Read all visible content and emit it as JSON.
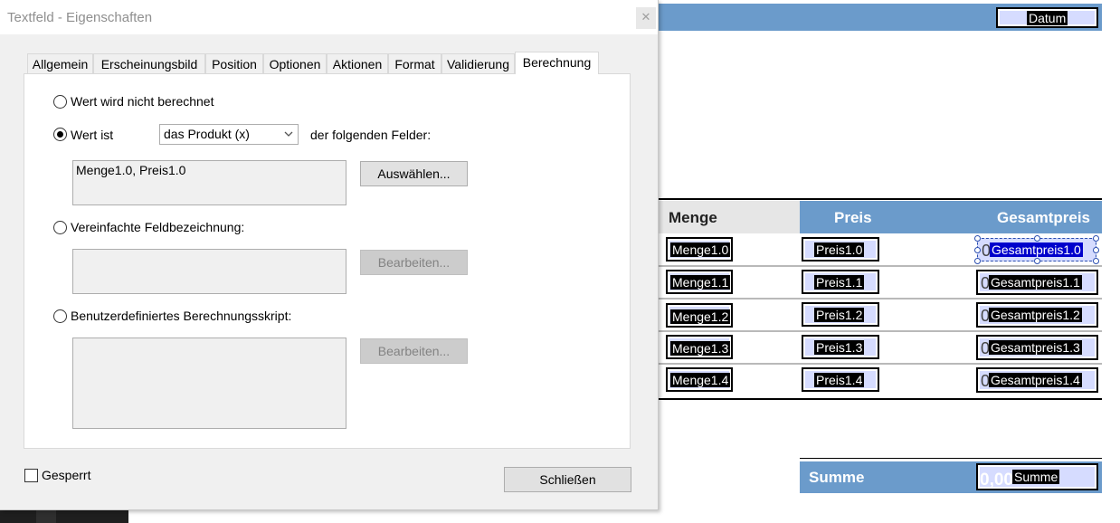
{
  "dialog": {
    "title": "Textfeld - Eigenschaften",
    "close_glyph": "✕",
    "tabs": [
      {
        "label": "Allgemein"
      },
      {
        "label": "Erscheinungsbild"
      },
      {
        "label": "Position"
      },
      {
        "label": "Optionen"
      },
      {
        "label": "Aktionen"
      },
      {
        "label": "Format"
      },
      {
        "label": "Validierung"
      },
      {
        "label": "Berechnung",
        "active": true
      }
    ],
    "calc": {
      "option_none": "Wert wird nicht berechnet",
      "option_value": "Wert ist",
      "operation_selected": "das Produkt (x)",
      "following_fields": "der folgenden Felder:",
      "fields_value": "Menge1.0, Preis1.0",
      "select_button": "Auswählen...",
      "option_simple": "Vereinfachte Feldbezeichnung:",
      "edit_button_1": "Bearbeiten...",
      "option_custom": "Benutzerdefiniertes Berechnungsskript:",
      "edit_button_2": "Bearbeiten..."
    },
    "locked_label": "Gesperrt",
    "close_button": "Schließen"
  },
  "form": {
    "date_field": "Datum",
    "headers": {
      "menge": "Menge",
      "preis": "Preis",
      "gesamtpreis": "Gesamtpreis"
    },
    "rows": [
      {
        "menge": "Menge1.0",
        "preis": "Preis1.0",
        "gesamt": "Gesamtpreis1.0"
      },
      {
        "menge": "Menge1.1",
        "preis": "Preis1.1",
        "gesamt": "Gesamtpreis1.1"
      },
      {
        "menge": "Menge1.2",
        "preis": "Preis1.2",
        "gesamt": "Gesamtpreis1.2"
      },
      {
        "menge": "Menge1.3",
        "preis": "Preis1.3",
        "gesamt": "Gesamtpreis1.3"
      },
      {
        "menge": "Menge1.4",
        "preis": "Preis1.4",
        "gesamt": "Gesamtpreis1.4"
      }
    ],
    "zero_value": "0",
    "sum_label": "Summe",
    "sum_value": "0,00",
    "sum_field": "Summe"
  },
  "colors": {
    "header_blue": "#6b9bcb",
    "field_fill": "#d6dcff",
    "selection_blue": "#0000cc"
  }
}
